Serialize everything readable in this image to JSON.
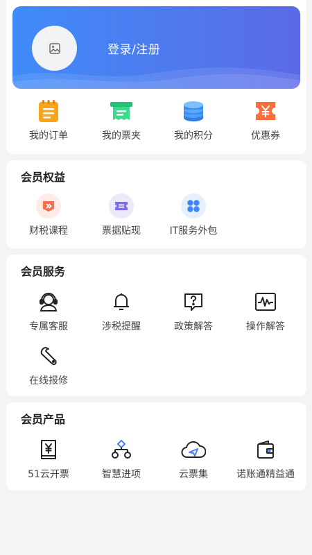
{
  "header": {
    "login_label": "登录/注册",
    "avatar_icon": "image-placeholder-icon",
    "gradient_colors": [
      "#3f8cf8",
      "#5b6ae8"
    ]
  },
  "quick_links": [
    {
      "label": "我的订单",
      "icon": "order-list-icon",
      "color": "#f6a21b"
    },
    {
      "label": "我的票夹",
      "icon": "ticket-folder-icon",
      "color": "#2fd17c"
    },
    {
      "label": "我的积分",
      "icon": "points-coins-icon",
      "color": "#3b8df3"
    },
    {
      "label": "优惠券",
      "icon": "coupon-icon",
      "color": "#fb6a3c"
    }
  ],
  "member_rights": {
    "title": "会员权益",
    "items": [
      {
        "label": "财税课程",
        "icon": "course-play-icon",
        "color": "#f2704a"
      },
      {
        "label": "票据贴现",
        "icon": "bill-discount-icon",
        "color": "#7a6cf0"
      },
      {
        "label": "IT服务外包",
        "icon": "it-service-icon",
        "color": "#3f88f2"
      }
    ]
  },
  "member_services": {
    "title": "会员服务",
    "items": [
      {
        "label": "专属客服",
        "icon": "customer-service-icon"
      },
      {
        "label": "涉税提醒",
        "icon": "bell-icon"
      },
      {
        "label": "政策解答",
        "icon": "question-chat-icon"
      },
      {
        "label": "操作解答",
        "icon": "waveform-monitor-icon"
      },
      {
        "label": "在线报修",
        "icon": "wrench-icon"
      }
    ]
  },
  "member_products": {
    "title": "会员产品",
    "items": [
      {
        "label": "51云开票",
        "icon": "yuan-receipt-icon"
      },
      {
        "label": "智慧进项",
        "icon": "flow-nodes-icon"
      },
      {
        "label": "云票集",
        "icon": "cloud-send-icon"
      },
      {
        "label": "诺账通精益通",
        "icon": "wallet-icon"
      }
    ]
  }
}
